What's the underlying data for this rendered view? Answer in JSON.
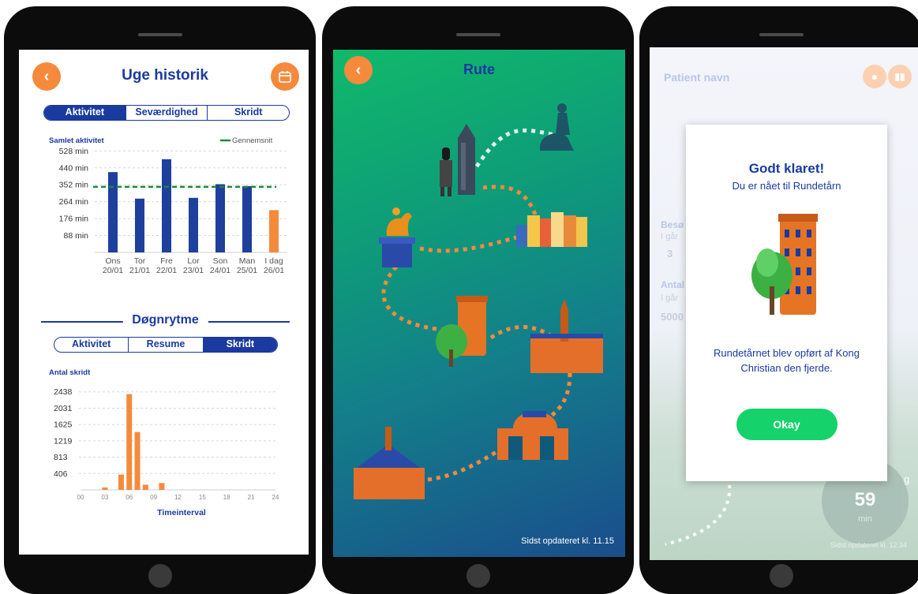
{
  "phone1": {
    "title": "Uge historik",
    "back_icon": "chevron-left-icon",
    "calendar_icon": "calendar-icon",
    "tabs": [
      {
        "label": "Aktivitet",
        "active": true
      },
      {
        "label": "Seværdighed",
        "active": false
      },
      {
        "label": "Skridt",
        "active": false
      }
    ],
    "section_title": "Døgnrytme",
    "tabs2": [
      {
        "label": "Aktivitet",
        "active": false
      },
      {
        "label": "Resume",
        "active": false
      },
      {
        "label": "Skridt",
        "active": true
      }
    ]
  },
  "phone2": {
    "title": "Rute",
    "back_icon": "chevron-left-icon",
    "updated": "Sidst opdateret kl. 11.15",
    "colors": {
      "top": "#0fb86c",
      "bottom": "#1a4d8c",
      "path": "#f58a3c"
    }
  },
  "phone3": {
    "patient_name": "Patient navn",
    "map_pin_icon": "map-pin-icon",
    "chart_icon": "bar-chart-icon",
    "bg_labels": [
      "Besø",
      "I går",
      "3",
      "Antal",
      "I går",
      "5000"
    ],
    "timer_value": "59",
    "timer_unit": "min",
    "timer_edge": "g",
    "updated": "Sidst opdateret kl. 12.34",
    "modal": {
      "heading": "Godt klaret!",
      "subheading": "Du er nået til Rundetårn",
      "body": "Rundetårnet blev opført af Kong Christian den fjerde.",
      "button": "Okay"
    }
  },
  "chart_data": [
    {
      "type": "bar",
      "title": "Samlet aktivitet",
      "categories": [
        "Ons 20/01",
        "Tor 21/01",
        "Fre 22/01",
        "Lor 23/01",
        "Son 24/01",
        "Man 25/01",
        "I dag 26/01"
      ],
      "category_lines": [
        [
          "Ons",
          "20/01"
        ],
        [
          "Tor",
          "21/01"
        ],
        [
          "Fre",
          "22/01"
        ],
        [
          "Lor",
          "23/01"
        ],
        [
          "Son",
          "24/01"
        ],
        [
          "Man",
          "25/01"
        ],
        [
          "I dag",
          "26/01"
        ]
      ],
      "values": [
        418,
        280,
        485,
        284,
        355,
        345,
        220
      ],
      "highlight_last": true,
      "average": {
        "name": "Gennemsnit",
        "value": 341
      },
      "yticks": [
        88,
        176,
        264,
        352,
        440,
        528
      ],
      "ytick_labels": [
        "88 min",
        "176 min",
        "264 min",
        "352 min",
        "440 min",
        "528 min"
      ],
      "ylim": [
        0,
        550
      ],
      "grid": true,
      "legend": "top-right",
      "colors": {
        "bar": "#1e3f9c",
        "today": "#f58a3c",
        "average": "#1a8a3a"
      }
    },
    {
      "type": "bar",
      "title": "Antal skridt",
      "xlabel": "Timeinterval",
      "x": [
        3,
        5,
        6,
        7,
        8,
        10
      ],
      "values": [
        60,
        380,
        2380,
        1440,
        130,
        170
      ],
      "xticks": [
        "00",
        "03",
        "06",
        "09",
        "12",
        "15",
        "18",
        "21",
        "24"
      ],
      "yticks": [
        406,
        813,
        1219,
        1625,
        2031,
        2438
      ],
      "ylim": [
        0,
        2550
      ],
      "xlim": [
        0,
        24
      ],
      "grid": true,
      "colors": {
        "bar": "#f58a3c"
      }
    }
  ]
}
